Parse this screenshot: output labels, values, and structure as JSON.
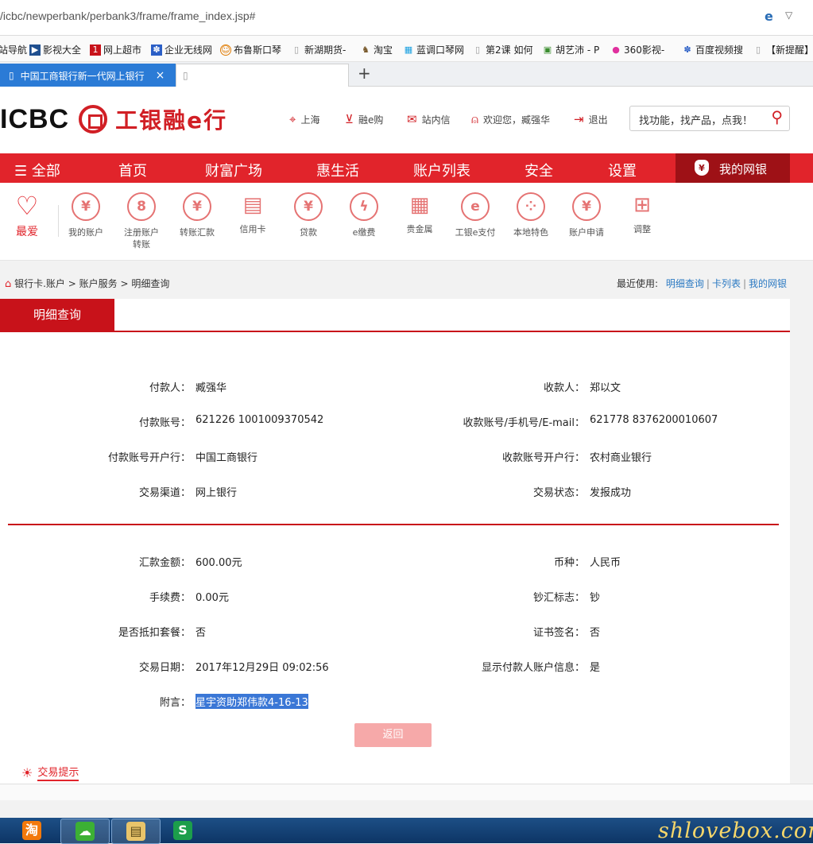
{
  "browser": {
    "url": "/icbc/newperbank/perbank3/frame/frame_index.jsp#",
    "favorites": [
      "站导航",
      "影视大全",
      "网上超市",
      "企业无线网",
      "布鲁斯口琴",
      "新湖期货-",
      "淘宝",
      "蓝调口琴网",
      "第2课 如何",
      "胡艺沛 - P",
      "360影视-",
      "百度视频搜",
      "【新提醒】"
    ],
    "tabs": [
      {
        "label": "中国工商银行新一代网上银行",
        "close": "×"
      },
      {
        "label": ""
      }
    ],
    "new_tab": "+"
  },
  "header": {
    "logo_en": "ICBC",
    "logo_cn": "工银融e行",
    "links": [
      "上海",
      "融e购",
      "站内信",
      "欢迎您，臧强华",
      "退出"
    ],
    "search_placeholder": "找功能，找产品，点我！"
  },
  "nav": {
    "menu_label": "全部",
    "items": [
      "首页",
      "财富广场",
      "惠生活",
      "账户列表",
      "安全",
      "设置"
    ],
    "mine": "我的网银"
  },
  "quick": {
    "fav_label": "最爱",
    "items": [
      {
        "label": "我的账户",
        "glyph": "¥"
      },
      {
        "label": "注册账户转账",
        "glyph": "8"
      },
      {
        "label": "转账汇款",
        "glyph": "¥"
      },
      {
        "label": "信用卡",
        "glyph": "▤"
      },
      {
        "label": "贷款",
        "glyph": "¥"
      },
      {
        "label": "e缴费",
        "glyph": "ϟ"
      },
      {
        "label": "贵金属",
        "glyph": "▦"
      },
      {
        "label": "工银e支付",
        "glyph": "e"
      },
      {
        "label": "本地特色",
        "glyph": "⁘"
      },
      {
        "label": "账户申请",
        "glyph": "¥"
      },
      {
        "label": "调整",
        "glyph": "⊞"
      }
    ]
  },
  "breadcrumb": {
    "parts": [
      "银行卡.账户",
      "账户服务",
      "明细查询"
    ],
    "sep": ">"
  },
  "recent": {
    "label": "最近使用:",
    "links": [
      "明细查询",
      "卡列表",
      "我的网银"
    ]
  },
  "panel": {
    "tab": "明细查询",
    "top_rows": [
      {
        "l_label": "付款人：",
        "l_value": "臧强华",
        "r_label": "收款人：",
        "r_value": "郑以文"
      },
      {
        "l_label": "付款账号：",
        "l_value": "621226 1001009370542",
        "r_label": "收款账号/手机号/E-mail：",
        "r_value": "621778 8376200010607"
      },
      {
        "l_label": "付款账号开户行：",
        "l_value": "中国工商银行",
        "r_label": "收款账号开户行：",
        "r_value": "农村商业银行"
      },
      {
        "l_label": "交易渠道：",
        "l_value": "网上银行",
        "r_label": "交易状态：",
        "r_value": "发报成功"
      }
    ],
    "bottom_rows": [
      {
        "l_label": "汇款金额：",
        "l_value": "600.00元",
        "r_label": "币种：",
        "r_value": "人民币"
      },
      {
        "l_label": "手续费：",
        "l_value": "0.00元",
        "r_label": "钞汇标志：",
        "r_value": "钞"
      },
      {
        "l_label": "是否抵扣套餐：",
        "l_value": "否",
        "r_label": "证书签名：",
        "r_value": "否"
      },
      {
        "l_label": "交易日期：",
        "l_value": "2017年12月29日 09:02:56",
        "r_label": "显示付款人账户信息：",
        "r_value": "是"
      }
    ],
    "memo_label": "附言：",
    "memo_value": "星宇资助郑伟款4-16-13",
    "back_button": "返回",
    "tips": "交易提示"
  },
  "taskbar": {
    "items": [
      "淘",
      "",
      "",
      "S"
    ]
  },
  "watermark": "shlovebox.com"
}
